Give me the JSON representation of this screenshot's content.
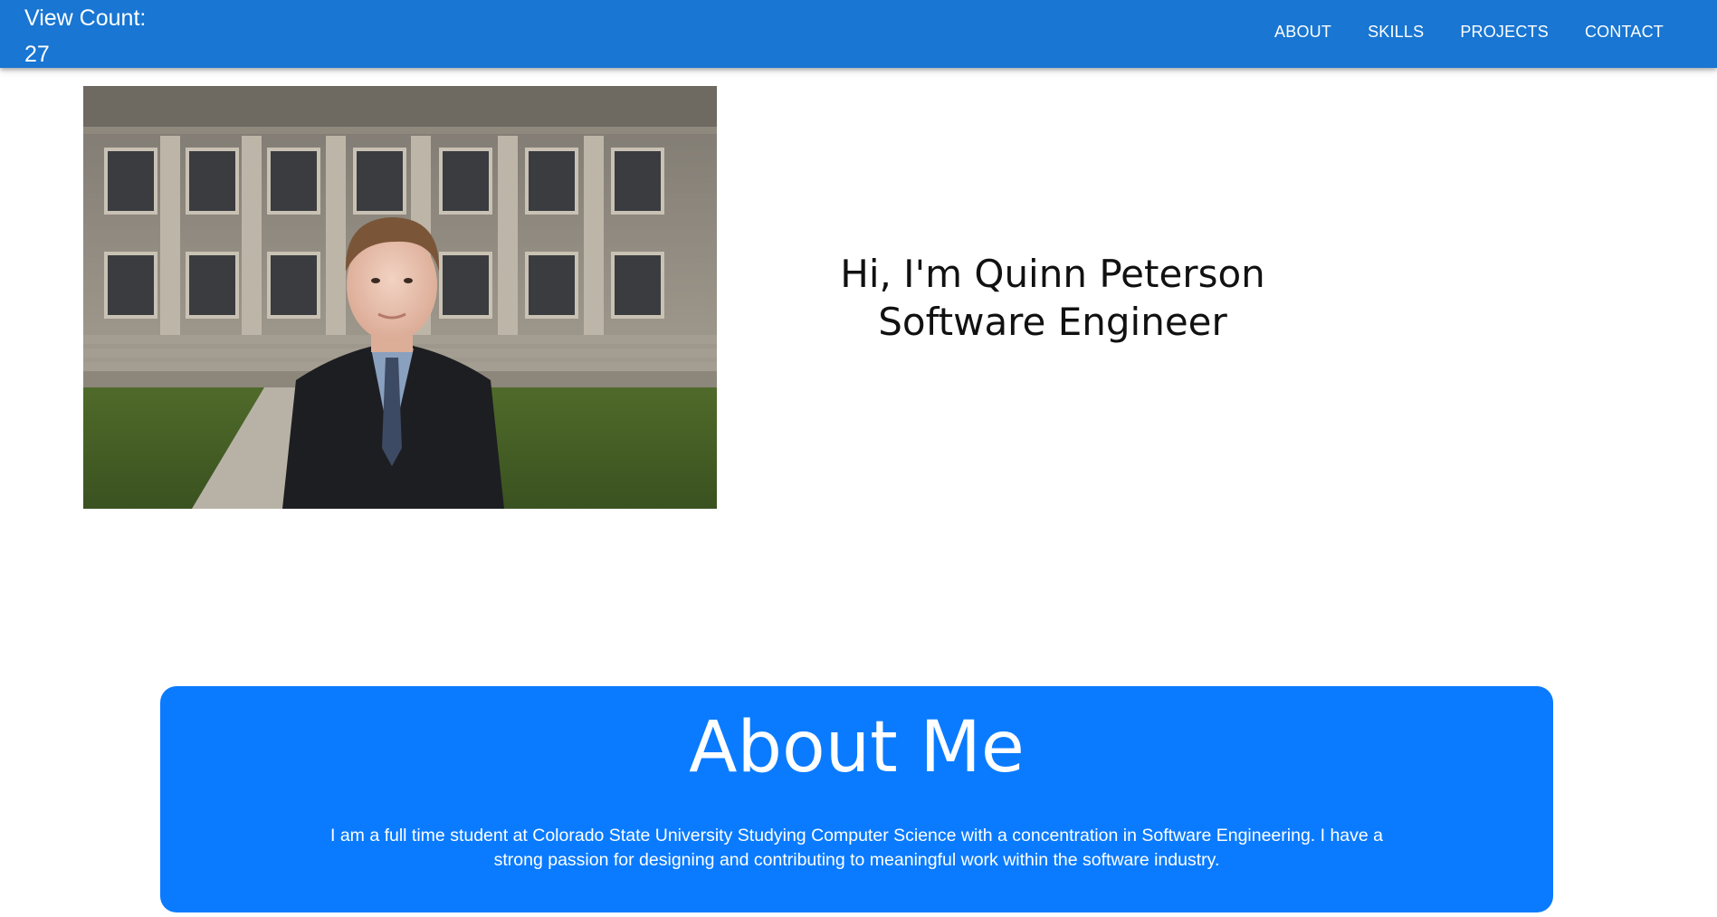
{
  "header": {
    "view_count_label": "View Count:",
    "view_count_value": "27",
    "nav": [
      "ABOUT",
      "SKILLS",
      "PROJECTS",
      "CONTACT"
    ]
  },
  "hero": {
    "greeting": "Hi, I'm Quinn Peterson",
    "role": "Software Engineer"
  },
  "about": {
    "title": "About Me",
    "body": "I am a full time student at Colorado State University Studying Computer Science with a concentration in Software Engineering. I have a strong passion for designing and contributing to meaningful work within the software industry."
  },
  "colors": {
    "appbar": "#1976d2",
    "about_card": "#0a7bff"
  }
}
